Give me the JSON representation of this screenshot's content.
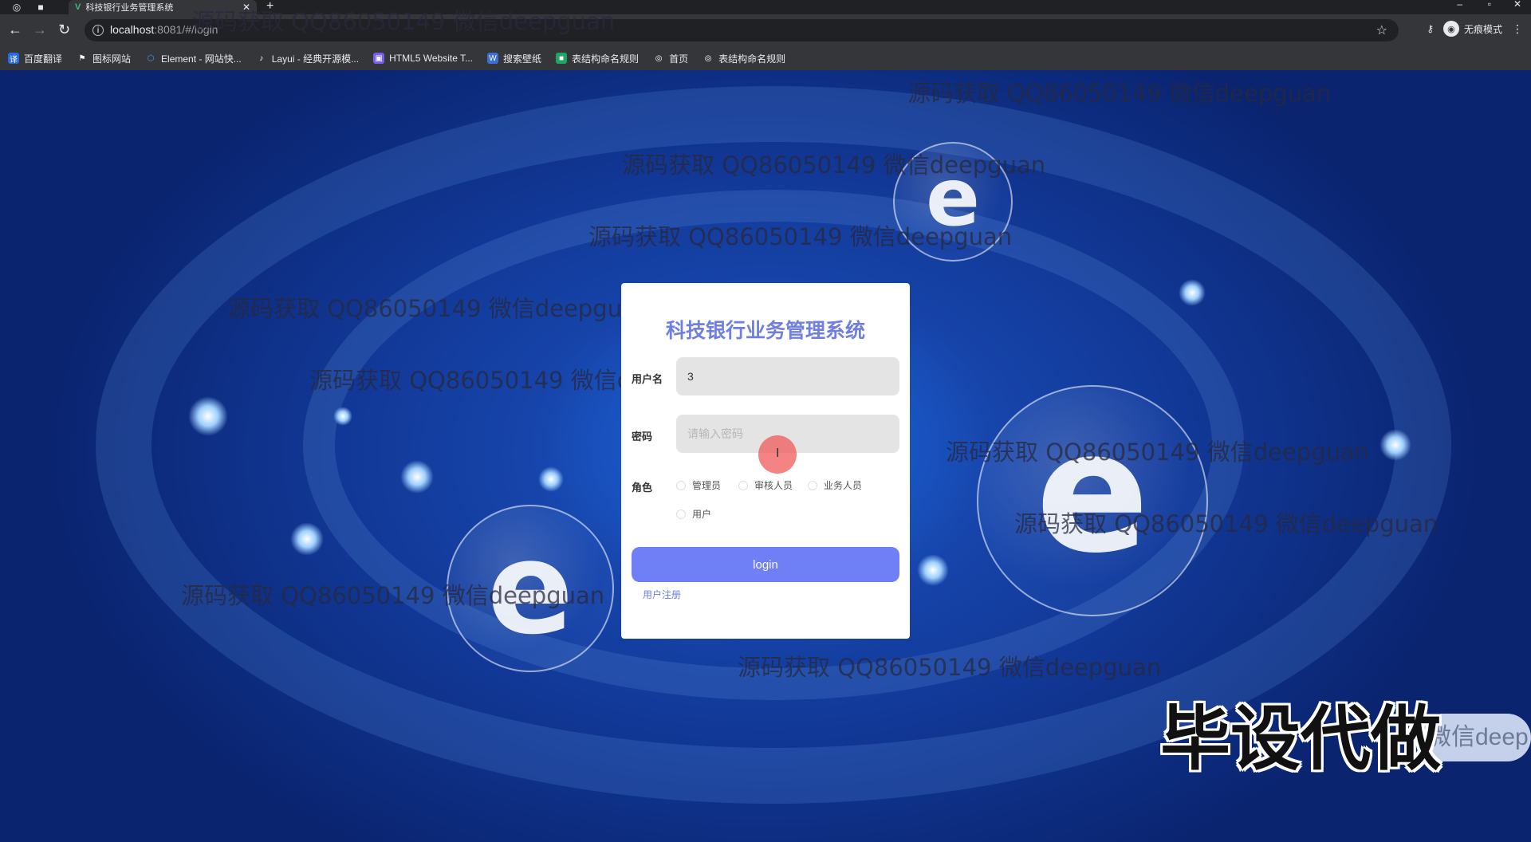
{
  "browser": {
    "tab_title": "科技银行业务管理系统",
    "tab_close": "✕",
    "new_tab": "+",
    "url_host": "localhost",
    "url_path": ":8081/#/login",
    "incognito_label": "无痕模式",
    "bookmarks": [
      {
        "label": "百度翻译",
        "color": "#2a6ae8",
        "glyph": "译"
      },
      {
        "label": "图标网站",
        "color": "#35363a",
        "glyph": "⚑"
      },
      {
        "label": "Element - 网站快...",
        "color": "#409eff",
        "glyph": "⬡"
      },
      {
        "label": "Layui - 经典开源模...",
        "color": "#35363a",
        "glyph": "♪"
      },
      {
        "label": "HTML5 Website T...",
        "color": "#7b5cf0",
        "glyph": "▣"
      },
      {
        "label": "搜索壁纸",
        "color": "#3a6fd8",
        "glyph": "W"
      },
      {
        "label": "表结构命名规则",
        "color": "#1fa463",
        "glyph": "■"
      },
      {
        "label": "首页",
        "color": "#35363a",
        "glyph": "◎"
      },
      {
        "label": "表结构命名规则",
        "color": "#35363a",
        "glyph": "◎"
      }
    ]
  },
  "login": {
    "title": "科技银行业务管理系统",
    "username_label": "用户名",
    "username_value": "3",
    "password_label": "密码",
    "password_placeholder": "请输入密码",
    "role_label": "角色",
    "roles": [
      "管理员",
      "审核人员",
      "业务人员",
      "用户"
    ],
    "login_button": "login",
    "register_link": "用户注册"
  },
  "watermark_text": "源码获取 QQ86050149 微信deepguan",
  "overlay": {
    "big_text": "毕设代做",
    "pill_text": "微信deep"
  },
  "colors": {
    "accent": "#6f7ff5",
    "title": "#6f7fe0",
    "chrome": "#35363a"
  }
}
